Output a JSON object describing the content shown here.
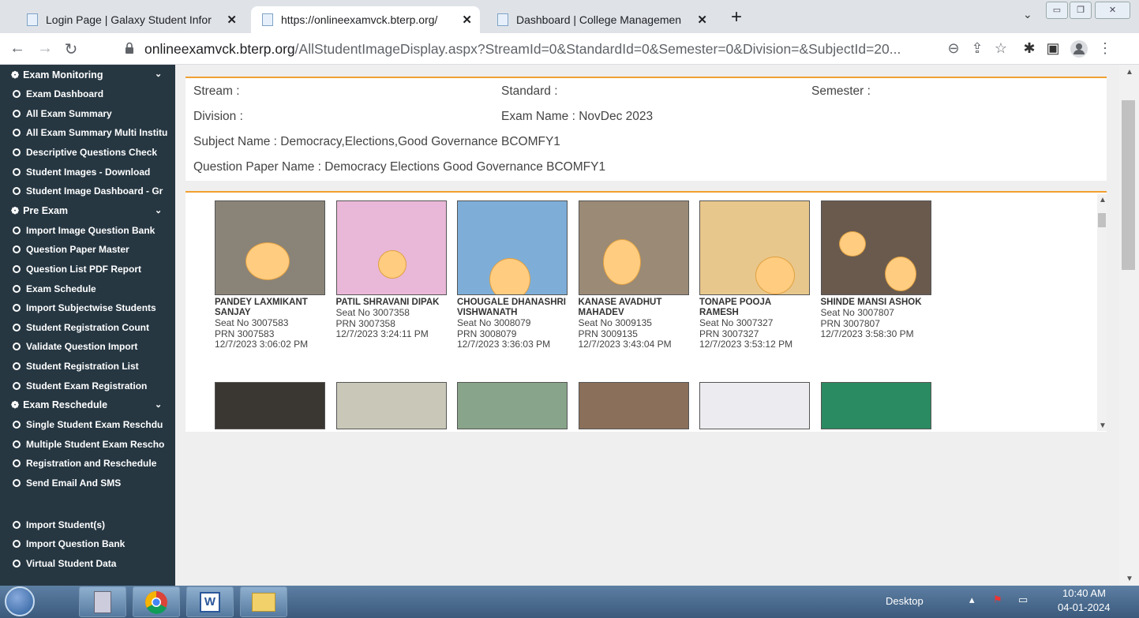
{
  "browser": {
    "tabs": [
      {
        "title": "Login Page | Galaxy Student Infor",
        "active": false
      },
      {
        "title": "https://onlineexamvck.bterp.org/",
        "active": true
      },
      {
        "title": "Dashboard | College Managemen",
        "active": false
      }
    ],
    "url_host": "onlineexamvck.bterp.org",
    "url_path": "/AllStudentImageDisplay.aspx?StreamId=0&StandardId=0&Semester=0&Division=&SubjectId=20..."
  },
  "sidebar": {
    "sections": [
      {
        "label": "Exam Monitoring",
        "items": [
          "Exam Dashboard",
          "All Exam Summary",
          "All Exam Summary Multi Institu",
          "Descriptive Questions Check",
          "Student Images - Download",
          "Student Image Dashboard - Gr"
        ]
      },
      {
        "label": "Pre Exam",
        "items": [
          "Import Image Question Bank",
          "Question Paper Master",
          "Question List PDF Report",
          "Exam Schedule",
          "Import Subjectwise Students",
          "Student Registration Count",
          "Validate Question Import",
          "Student Registration List",
          "Student Exam Registration"
        ]
      },
      {
        "label": "Exam Reschedule",
        "items": [
          "Single Student Exam Reschdu",
          "Multiple Student Exam Rescho",
          "Registration and Reschedule",
          "Send Email And SMS"
        ]
      }
    ],
    "extra_items": [
      "Import Student(s)",
      "Import Question Bank",
      "Virtual Student Data"
    ]
  },
  "info": {
    "stream": "Stream :",
    "standard": "Standard :",
    "semester": "Semester :",
    "division": "Division :",
    "exam_name": "Exam Name : NovDec 2023",
    "subject_name": "Subject Name : Democracy,Elections,Good Governance BCOMFY1",
    "paper_name": "Question Paper Name : Democracy Elections Good Governance BCOMFY1"
  },
  "students": [
    {
      "name": "PANDEY LAXMIKANT SANJAY",
      "seat": "Seat No 3007583",
      "prn": "PRN 3007583",
      "time": "12/7/2023 3:06:02 PM",
      "bg": "#8a8378"
    },
    {
      "name": "PATIL SHRAVANI DIPAK",
      "seat": "Seat No 3007358",
      "prn": "PRN 3007358",
      "time": "12/7/2023 3:24:11 PM",
      "bg": "#e9b8d8"
    },
    {
      "name": "CHOUGALE DHANASHRI VISHWANATH",
      "seat": "Seat No 3008079",
      "prn": "PRN 3008079",
      "time": "12/7/2023 3:36:03 PM",
      "bg": "#7eaed8"
    },
    {
      "name": "KANASE AVADHUT MAHADEV",
      "seat": "Seat No 3009135",
      "prn": "PRN 3009135",
      "time": "12/7/2023 3:43:04 PM",
      "bg": "#9a8a76"
    },
    {
      "name": "TONAPE POOJA RAMESH",
      "seat": "Seat No 3007327",
      "prn": "PRN 3007327",
      "time": "12/7/2023 3:53:12 PM",
      "bg": "#e8c78c"
    },
    {
      "name": "SHINDE MANSI ASHOK",
      "seat": "Seat No 3007807",
      "prn": "PRN 3007807",
      "time": "12/7/2023 3:58:30 PM",
      "bg": "#6a5a4e"
    }
  ],
  "second_row_colors": [
    "#3a3632",
    "#c9c8b8",
    "#88a48a",
    "#8a6f5a",
    "#ecebf0",
    "#2a8a62"
  ],
  "taskbar": {
    "desktop": "Desktop",
    "time": "10:40 AM",
    "date": "04-01-2024"
  }
}
